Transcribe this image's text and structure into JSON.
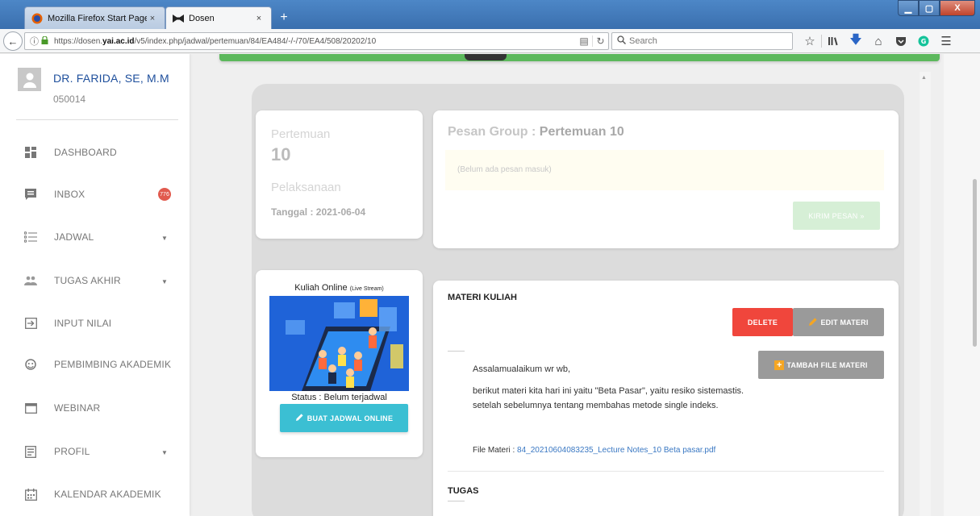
{
  "browser": {
    "tabs": [
      {
        "title": "Mozilla Firefox Start Page",
        "close": "×"
      },
      {
        "title": "Dosen",
        "close": "×"
      }
    ],
    "new_tab": "+",
    "window_controls": {
      "minimize": "▁",
      "maximize": "▢",
      "close": "X"
    },
    "url_prefix": "https://dosen.",
    "url_domain": "yai.ac.id",
    "url_path": "/v5/index.php/jadwal/pertemuan/84/EA484/-/-/70/EA4/508/20202/10",
    "search_placeholder": "Search",
    "toolbar_icons": [
      "star-icon",
      "library-icon",
      "download-icon",
      "home-icon",
      "pocket-icon",
      "grammarly-icon",
      "menu-icon"
    ]
  },
  "sidebar": {
    "user_name": "DR. FARIDA, SE, M.M",
    "user_id": "050014",
    "items": [
      {
        "label": "DASHBOARD",
        "icon": "dashboard-icon"
      },
      {
        "label": "INBOX",
        "icon": "inbox-icon",
        "badge": "776"
      },
      {
        "label": "JADWAL",
        "icon": "list-icon",
        "has_children": true
      },
      {
        "label": "TUGAS AKHIR",
        "icon": "group-icon",
        "has_children": true
      },
      {
        "label": "INPUT NILAI",
        "icon": "input-icon"
      },
      {
        "label": "PEMBIMBING AKADEMIK",
        "icon": "face-icon"
      },
      {
        "label": "WEBINAR",
        "icon": "webinar-icon"
      },
      {
        "label": "PROFIL",
        "icon": "profile-icon",
        "has_children": true
      },
      {
        "label": "KALENDAR AKADEMIK",
        "icon": "calendar-icon"
      }
    ]
  },
  "meeting": {
    "label": "Pertemuan",
    "number": "10",
    "exec_label": "Pelaksanaan",
    "date": "Tanggal : 2021-06-04"
  },
  "messages": {
    "title_prefix": "Pesan Group : ",
    "title_accent": "Pertemuan 10",
    "empty": "(Belum ada pesan masuk)",
    "send_label": "KIRIM PESAN »"
  },
  "online": {
    "title": "Kuliah Online ",
    "title_small": "(Live Stream)",
    "status": "Status : Belum terjadwal",
    "button": "BUAT JADWAL ONLINE"
  },
  "materi": {
    "title": "MATERI KULIAH",
    "delete_label": "DELETE",
    "edit_label": "EDIT MATERI",
    "add_file_label": "TAMBAH FILE MATERI",
    "greeting": "Assalamualaikum wr wb,",
    "body_line1": "berikut materi kita hari ini yaitu \"Beta Pasar\", yaitu resiko sistemastis.",
    "body_line2": "setelah sebelumnya tentang membahas metode single indeks.",
    "file_label": "File Materi : ",
    "file_name": "84_20210604083235_Lecture Notes_10 Beta pasar.pdf",
    "tugas_title": "TUGAS"
  },
  "colors": {
    "accent_green": "#5cb85c",
    "user_blue": "#1e4f9c",
    "badge_red": "#e15a4e",
    "delete_red": "#f0463c",
    "cyan": "#3bbfd3",
    "link_blue": "#3a78c3"
  }
}
